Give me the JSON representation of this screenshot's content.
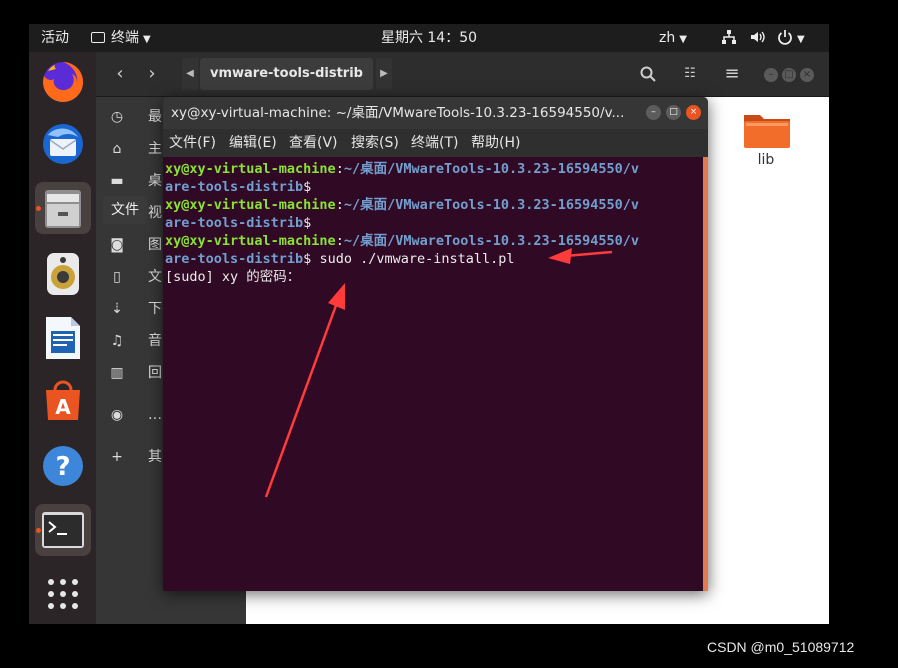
{
  "topbar": {
    "activities": "活动",
    "app_menu": "终端",
    "clock": "星期六 14：50",
    "lang": "zh"
  },
  "dock": {
    "items": [
      "firefox",
      "thunderbird",
      "files",
      "rhythmbox",
      "libreoffice-writer",
      "software-center",
      "help",
      "terminal",
      "show-apps"
    ]
  },
  "files_window": {
    "path_label": "vmware-tools-distrib",
    "tooltip": "文件",
    "sidebar": [
      "最",
      "主",
      "桌",
      "视",
      "图",
      "文",
      "下",
      "音",
      "回",
      "…",
      "其"
    ],
    "folder_label": "lib"
  },
  "terminal": {
    "title": "xy@xy-virtual-machine: ~/桌面/VMwareTools-10.3.23-16594550/v...",
    "menu": [
      "文件(F)",
      "编辑(E)",
      "查看(V)",
      "搜索(S)",
      "终端(T)",
      "帮助(H)"
    ],
    "user_host": "xy@xy-virtual-machine",
    "path_part1": "~/桌面/VMwareTools-10.3.23-16594550/v",
    "path_part2": "are-tools-distrib",
    "prompt_suffix": "$",
    "command": " sudo ./vmware-install.pl",
    "sudo_prompt": "[sudo] xy 的密码："
  },
  "colors": {
    "terminal_bg": "#300a24",
    "user_green": "#8ae234",
    "path_blue": "#729fcf",
    "accent_orange": "#e95420",
    "arrow_red": "#ff3b3b"
  },
  "watermark": "CSDN @m0_51089712"
}
